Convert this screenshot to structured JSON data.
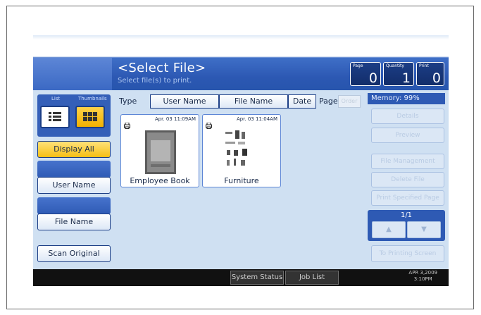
{
  "header": {
    "title": "<Select File>",
    "subtitle": "Select file(s) to print."
  },
  "counters": {
    "page": {
      "label": "Page",
      "value": "0"
    },
    "quantity": {
      "label": "Quantity",
      "value": "1"
    },
    "print": {
      "label": "Print",
      "value": "0"
    }
  },
  "left_panel": {
    "tab_list": "List",
    "tab_thumbnails": "Thumbnails",
    "display_all": "Display All",
    "user_name": "User Name",
    "file_name": "File Name",
    "scan_original": "Scan Original"
  },
  "columns": {
    "type": "Type",
    "user_name": "User Name",
    "file_name": "File Name",
    "date": "Date",
    "page": "Page",
    "order": "Order"
  },
  "files": [
    {
      "date": "Apr. 03  11:09AM",
      "name": "Employee Book"
    },
    {
      "date": "Apr. 03  11:04AM",
      "name": "Furniture"
    }
  ],
  "right_panel": {
    "memory": "Memory: 99%",
    "details": "Details",
    "preview": "Preview",
    "file_management": "File Management",
    "delete_file": "Delete File",
    "print_specified_page": "Print Specified Page",
    "pager": "1/1",
    "to_printing_screen": "To Printing Screen"
  },
  "footer": {
    "system_status": "System Status",
    "job_list": "Job List",
    "date": "APR  3,2009",
    "time": "3:10PM"
  },
  "colors": {
    "accent_blue": "#2c58b3",
    "highlight_yellow": "#f6bf14",
    "panel_bg": "#cfe0f2"
  }
}
